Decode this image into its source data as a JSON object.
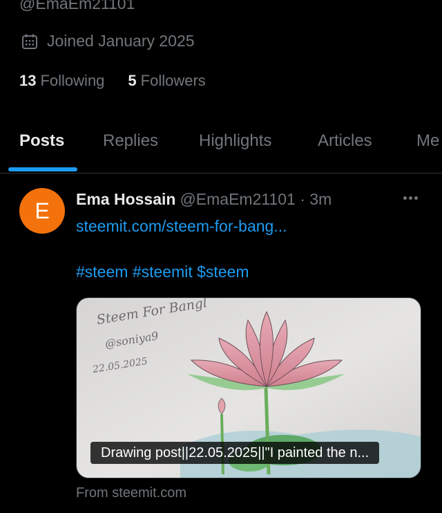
{
  "profile": {
    "handle": "@EmaEm21101",
    "joined": "Joined January 2025",
    "following_count": "13",
    "following_label": "Following",
    "followers_count": "5",
    "followers_label": "Followers"
  },
  "tabs": [
    {
      "label": "Posts",
      "active": true
    },
    {
      "label": "Replies"
    },
    {
      "label": "Highlights"
    },
    {
      "label": "Articles"
    },
    {
      "label": "Me"
    }
  ],
  "post": {
    "avatar_letter": "E",
    "author_name": "Ema Hossain",
    "meta": "@EmaEm21101 · 3m",
    "link_text": "steemit.com/steem-for-bang...",
    "tags": "#steem #steemit $steem",
    "card": {
      "caption": "Drawing post||22.05.2025||\"I painted the n...",
      "image_text": {
        "line1": "Steem For Bangl",
        "line2": "@soniya9",
        "line3": "22.05.2025"
      }
    },
    "source": "From steemit.com"
  },
  "colors": {
    "accent": "#1d9bf0",
    "avatar_bg": "#f4720b",
    "muted": "#71767b",
    "text": "#e7e9ea"
  },
  "icons": [
    "calendar-icon",
    "more-icon"
  ]
}
